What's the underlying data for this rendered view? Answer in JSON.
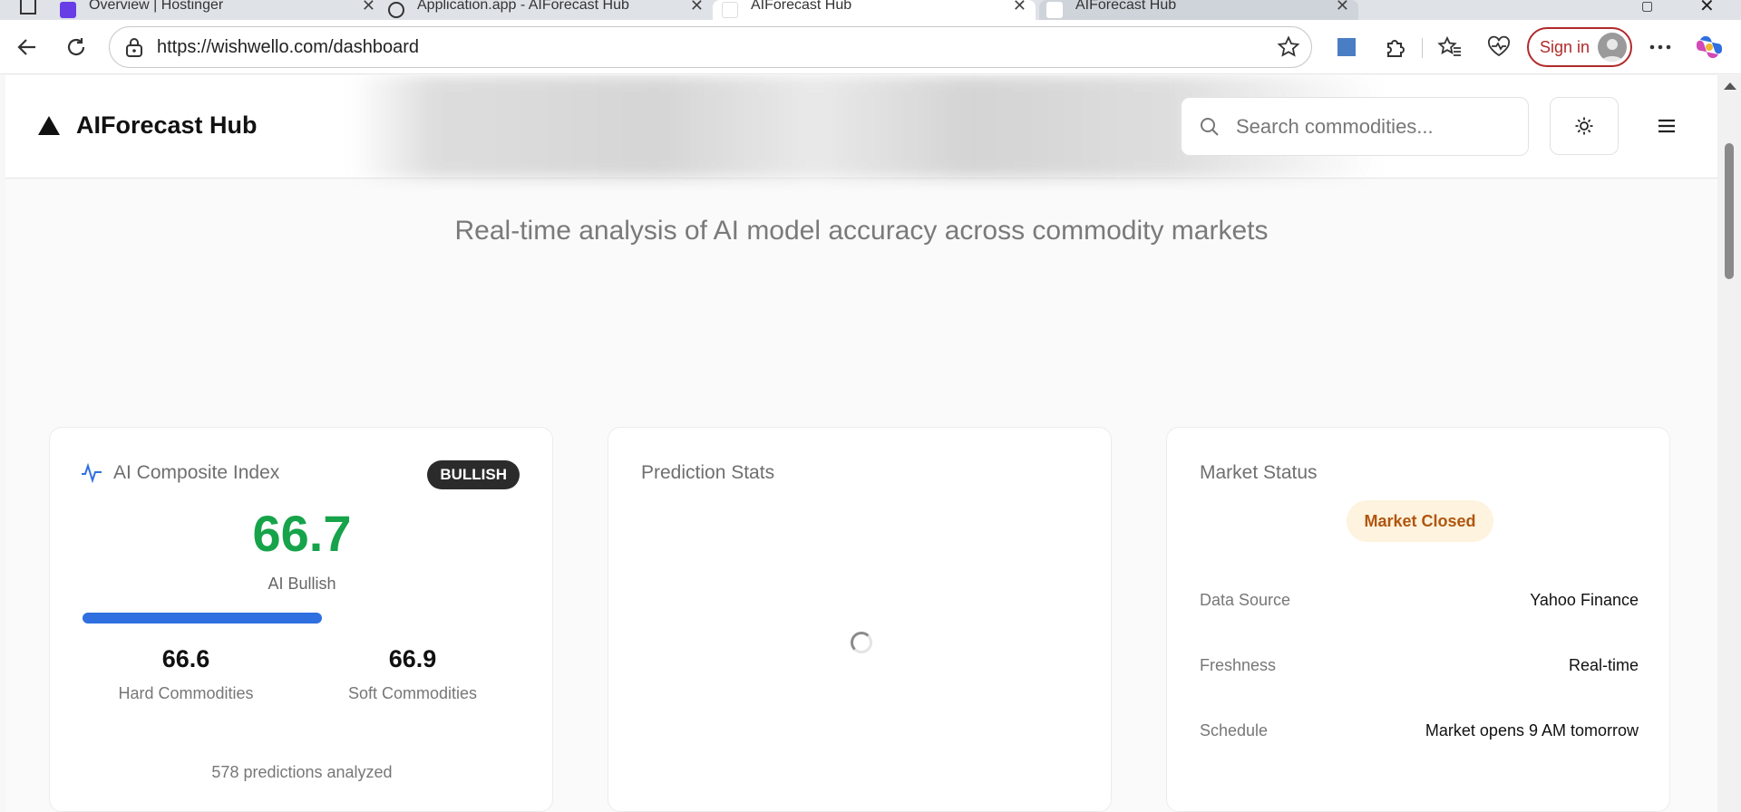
{
  "browser": {
    "tabs": [
      {
        "title": "Overview | Hostinger"
      },
      {
        "title": "Application.app - AIForecast Hub"
      },
      {
        "title": "AIForecast Hub"
      },
      {
        "title": "AIForecast Hub"
      }
    ],
    "url": "https://wishwello.com/dashboard",
    "sign_in_label": "Sign in"
  },
  "site": {
    "brand": "AIForecast Hub",
    "search_placeholder": "Search commodities...",
    "tagline": "Real-time analysis of AI model accuracy across commodity markets"
  },
  "composite": {
    "title": "AI Composite Index",
    "badge": "BULLISH",
    "value": "66.7",
    "value_label": "AI Bullish",
    "progress_fraction": 0.545,
    "hard_value": "66.6",
    "hard_label": "Hard Commodities",
    "soft_value": "66.9",
    "soft_label": "Soft Commodities",
    "footer": "578 predictions analyzed",
    "colors": {
      "value": "#16a34a",
      "bar": "#2f6fe0",
      "badge_bg": "#2b2b2b"
    }
  },
  "prediction": {
    "title": "Prediction Stats"
  },
  "market": {
    "title": "Market Status",
    "status": "Market Closed",
    "rows": [
      {
        "label": "Data Source",
        "value": "Yahoo Finance"
      },
      {
        "label": "Freshness",
        "value": "Real-time"
      },
      {
        "label": "Schedule",
        "value": "Market opens 9 AM tomorrow"
      }
    ],
    "colors": {
      "status_bg": "#fdf3de",
      "status_text": "#b0560e"
    }
  },
  "icons": [
    "back-icon",
    "refresh-icon",
    "lock-icon",
    "star-icon",
    "extensions-icon",
    "favorites-icon",
    "health-icon",
    "more-icon",
    "copilot-icon",
    "search-icon",
    "sun-icon",
    "menu-icon",
    "pulse-icon",
    "spinner"
  ]
}
